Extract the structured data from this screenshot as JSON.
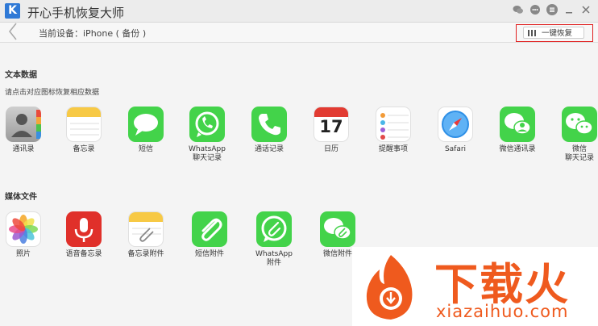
{
  "app": {
    "logo_letter": "K",
    "title": "开心手机恢复大师"
  },
  "toolbar": {
    "device_label": "当前设备：iPhone ( 备份 )",
    "restore_label": "一键恢复"
  },
  "text_section": {
    "title": "文本数据",
    "hint": "请点击对应图标恢复相应数据",
    "items": [
      {
        "label": "通讯录",
        "icon": "contacts-icon"
      },
      {
        "label": "备忘录",
        "icon": "notes-icon"
      },
      {
        "label": "短信",
        "icon": "messages-icon"
      },
      {
        "label": "WhatsApp\n聊天记录",
        "icon": "whatsapp-icon"
      },
      {
        "label": "通话记录",
        "icon": "phone-icon"
      },
      {
        "label": "日历",
        "icon": "calendar-icon",
        "date": "17"
      },
      {
        "label": "提醒事项",
        "icon": "reminders-icon"
      },
      {
        "label": "Safari",
        "icon": "safari-icon"
      },
      {
        "label": "微信通讯录",
        "icon": "wechat-contacts-icon"
      },
      {
        "label": "微信\n聊天记录",
        "icon": "wechat-icon"
      }
    ]
  },
  "media_section": {
    "title": "媒体文件",
    "items": [
      {
        "label": "照片",
        "icon": "photos-icon"
      },
      {
        "label": "语音备忘录",
        "icon": "voice-memo-icon"
      },
      {
        "label": "备忘录附件",
        "icon": "notes-attachment-icon"
      },
      {
        "label": "短信附件",
        "icon": "sms-attachment-icon"
      },
      {
        "label": "WhatsApp\n附件",
        "icon": "whatsapp-attachment-icon"
      },
      {
        "label": "微信附件",
        "icon": "wechat-attachment-icon"
      }
    ]
  },
  "watermark": {
    "cn": "下载火",
    "en": "xiazaihuo.com"
  },
  "colors": {
    "accent_green": "#43d34a",
    "highlight_red": "#e02020",
    "watermark_orange": "#ef5a1e"
  }
}
